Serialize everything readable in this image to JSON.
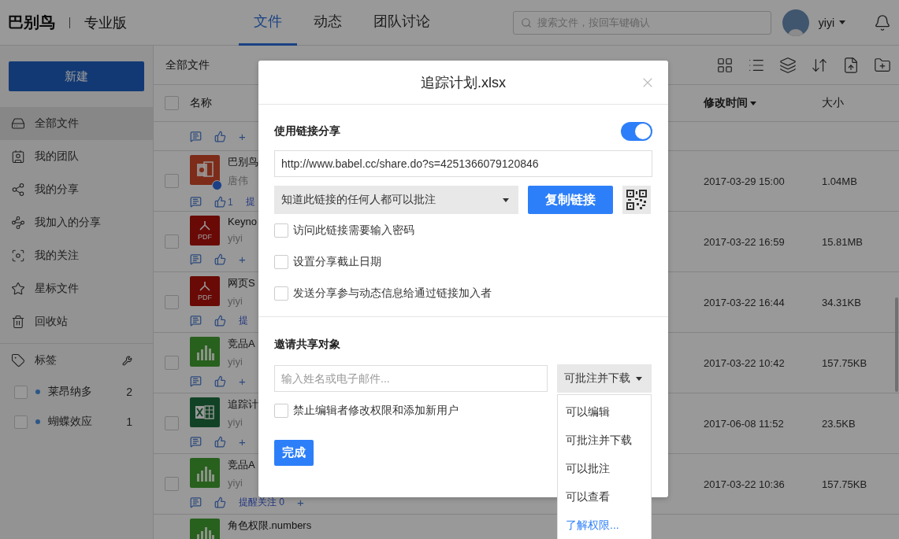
{
  "app": {
    "logo": "巴别鸟",
    "edition": "专业版"
  },
  "nav_tabs": [
    {
      "label": "文件",
      "selected": true
    },
    {
      "label": "动态",
      "selected": false
    },
    {
      "label": "团队讨论",
      "selected": false
    }
  ],
  "search": {
    "placeholder": "搜索文件，按回车键确认"
  },
  "user": {
    "name": "yiyi"
  },
  "sidebar": {
    "new_button": "新建",
    "items": [
      {
        "label": "全部文件",
        "selected": true
      },
      {
        "label": "我的团队",
        "selected": false
      },
      {
        "label": "我的分享",
        "selected": false
      },
      {
        "label": "我加入的分享",
        "selected": false
      },
      {
        "label": "我的关注",
        "selected": false
      },
      {
        "label": "星标文件",
        "selected": false
      },
      {
        "label": "回收站",
        "selected": false
      }
    ],
    "tags_heading": "标签",
    "tags": [
      {
        "label": "莱昂纳多",
        "count": "2",
        "checked": false
      },
      {
        "label": "蝴蝶效应",
        "count": "1",
        "checked": false
      }
    ]
  },
  "files": {
    "breadcrumb": "全部文件",
    "select_all_checked": false,
    "columns": [
      {
        "label": "名称",
        "sorted": false
      },
      {
        "label": "修改时间",
        "sorted": true
      },
      {
        "label": "大小",
        "sorted": false
      }
    ],
    "rows": [
      {
        "kind": "partial",
        "add": "+"
      },
      {
        "kind": "ppt",
        "checked": false,
        "shared": true,
        "name": "巴别鸟",
        "owner": "唐伟",
        "likes": "1",
        "follow": "提",
        "modified": "2017-03-29 15:00",
        "size": "1.04MB"
      },
      {
        "kind": "pdf",
        "checked": false,
        "icon_label": "PDF",
        "name": "Keyno",
        "owner": "yiyi",
        "add": "+",
        "modified": "2017-03-22 16:59",
        "size": "15.81MB"
      },
      {
        "kind": "pdf",
        "checked": false,
        "icon_label": "PDF",
        "name": "网页S",
        "owner": "yiyi",
        "follow": "提",
        "modified": "2017-03-22 16:44",
        "size": "34.31KB"
      },
      {
        "kind": "numbers",
        "checked": false,
        "name": "竞品A",
        "owner": "yiyi",
        "add": "+",
        "modified": "2017-03-22 10:42",
        "size": "157.75KB"
      },
      {
        "kind": "xlsx",
        "checked": false,
        "name": "追踪计",
        "owner": "yiyi",
        "add": "+",
        "modified": "2017-06-08 11:52",
        "size": "23.5KB"
      },
      {
        "kind": "numbers",
        "checked": false,
        "name": "竞品A",
        "owner": "yiyi",
        "follow": "提醒关注 0",
        "add": "+",
        "modified": "2017-03-22 10:36",
        "size": "157.75KB"
      },
      {
        "kind": "numbers",
        "name": "角色权限.numbers"
      }
    ]
  },
  "dialog": {
    "title": "追踪计划.xlsx",
    "link_share": {
      "label": "使用链接分享",
      "on": true,
      "url": "http://www.babel.cc/share.do?s=4251366079120846",
      "access": "知道此链接的任何人都可以批注",
      "copy_button": "复制链接",
      "options": [
        {
          "label": "访问此链接需要输入密码",
          "checked": false
        },
        {
          "label": "设置分享截止日期",
          "checked": false
        },
        {
          "label": "发送分享参与动态信息给通过链接加入者",
          "checked": false
        }
      ]
    },
    "invite": {
      "heading": "邀请共享对象",
      "placeholder": "输入姓名或电子邮件...",
      "permission": "可批注并下载",
      "lock_option": {
        "label": "禁止编辑者修改权限和添加新用户",
        "checked": false
      },
      "menu": [
        {
          "kind": "option",
          "label": "可以编辑",
          "selected": false
        },
        {
          "kind": "option",
          "label": "可批注并下载",
          "selected": false
        },
        {
          "kind": "option",
          "label": "可以批注",
          "selected": false
        },
        {
          "kind": "option",
          "label": "可以查看",
          "selected": false
        },
        {
          "kind": "link",
          "label": "了解权限..."
        }
      ]
    },
    "done_button": "完成"
  }
}
